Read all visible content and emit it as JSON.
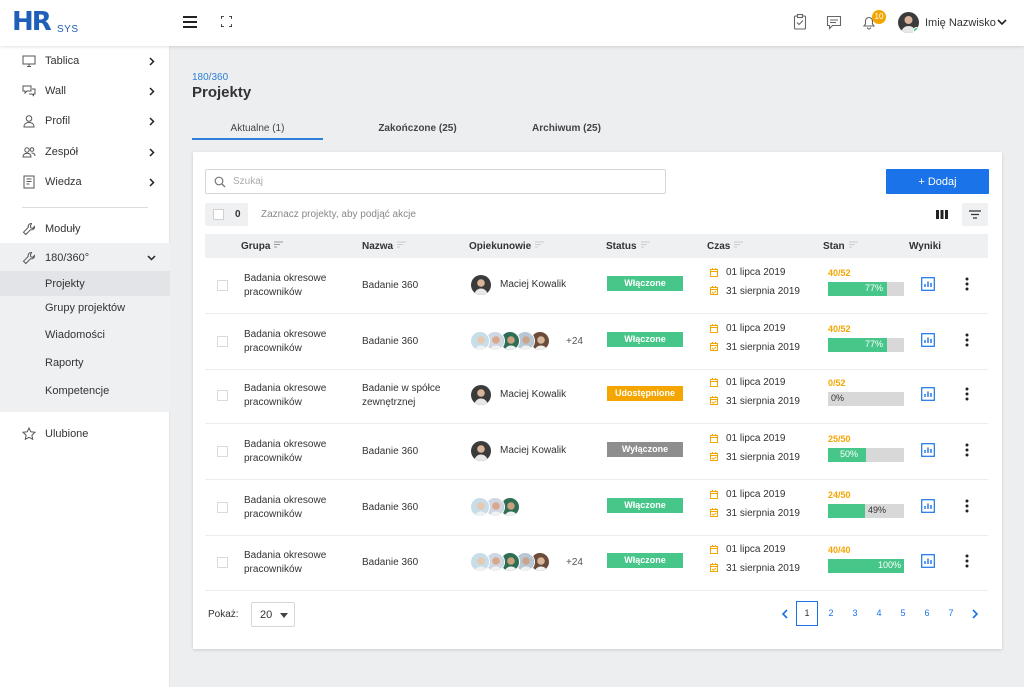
{
  "app": {
    "logo_main": "HR",
    "logo_sub": "SYS"
  },
  "topbar": {
    "notification_count": "10",
    "user_name": "Imię Nazwisko"
  },
  "sidebar": {
    "items": [
      {
        "label": "Tablica"
      },
      {
        "label": "Wall"
      },
      {
        "label": "Profil"
      },
      {
        "label": "Zespół"
      },
      {
        "label": "Wiedza"
      },
      {
        "label": "Moduły"
      },
      {
        "label": "180/360°"
      },
      {
        "label": "Ulubione"
      }
    ],
    "sub_items": [
      {
        "label": "Projekty"
      },
      {
        "label": "Grupy projektów"
      },
      {
        "label": "Wiadomości"
      },
      {
        "label": "Raporty"
      },
      {
        "label": "Kompetencje"
      }
    ]
  },
  "header": {
    "breadcrumb": "180/360",
    "title": "Projekty"
  },
  "tabs": [
    {
      "label": "Aktualne (1)"
    },
    {
      "label": "Zakończone (25)"
    },
    {
      "label": "Archiwum (25)"
    }
  ],
  "toolbar": {
    "search_placeholder": "Szukaj",
    "add_label": "+ Dodaj",
    "selected_count": "0",
    "selection_hint": "Zaznacz projekty, aby podjąć akcje"
  },
  "table": {
    "headers": {
      "grupa": "Grupa",
      "nazwa": "Nazwa",
      "opiekunowie": "Opiekunowie",
      "status": "Status",
      "czas": "Czas",
      "stan": "Stan",
      "wyniki": "Wyniki"
    },
    "status_colors": {
      "Włączone": "#47c68a",
      "Udostępnione": "#f5a500",
      "Wyłączone": "#8e8e8e"
    },
    "rows": [
      {
        "grupa": "Badania okresowe pracowników",
        "nazwa": "Badanie 360",
        "nazwa_lines": 1,
        "caretakers_mode": "single",
        "caretaker_name": "Maciej Kowalik",
        "more_count": "",
        "status": "Włączone",
        "date_start": "01 lipca 2019",
        "date_end": "31 sierpnia 2019",
        "stan": "40/52",
        "progress": 77,
        "progress_label": "77%"
      },
      {
        "grupa": "Badania okresowe pracowników",
        "nazwa": "Badanie 360",
        "nazwa_lines": 1,
        "caretakers_mode": "multi5",
        "caretaker_name": "",
        "more_count": "+24",
        "status": "Włączone",
        "date_start": "01 lipca 2019",
        "date_end": "31 sierpnia 2019",
        "stan": "40/52",
        "progress": 77,
        "progress_label": "77%"
      },
      {
        "grupa": "Badania okresowe pracowników",
        "nazwa": "Badanie w spółce zewnętrznej",
        "nazwa_lines": 2,
        "caretakers_mode": "single",
        "caretaker_name": "Maciej Kowalik",
        "more_count": "",
        "status": "Udostępnione",
        "date_start": "01 lipca 2019",
        "date_end": "31 sierpnia 2019",
        "stan": "0/52",
        "progress": 0,
        "progress_label": "0%"
      },
      {
        "grupa": "Badania okresowe pracowników",
        "nazwa": "Badanie 360",
        "nazwa_lines": 1,
        "caretakers_mode": "single",
        "caretaker_name": "Maciej Kowalik",
        "more_count": "",
        "status": "Wyłączone",
        "date_start": "01 lipca 2019",
        "date_end": "31 sierpnia 2019",
        "stan": "25/50",
        "progress": 50,
        "progress_label": "50%"
      },
      {
        "grupa": "Badania okresowe pracowników",
        "nazwa": "Badanie 360",
        "nazwa_lines": 1,
        "caretakers_mode": "multi3",
        "caretaker_name": "",
        "more_count": "",
        "status": "Włączone",
        "date_start": "01 lipca 2019",
        "date_end": "31 sierpnia 2019",
        "stan": "24/50",
        "progress": 49,
        "progress_label": "49%"
      },
      {
        "grupa": "Badania okresowe pracowników",
        "nazwa": "Badanie 360",
        "nazwa_lines": 1,
        "caretakers_mode": "multi5",
        "caretaker_name": "",
        "more_count": "+24",
        "status": "Włączone",
        "date_start": "01 lipca 2019",
        "date_end": "31 sierpnia 2019",
        "stan": "40/40",
        "progress": 100,
        "progress_label": "100%"
      }
    ]
  },
  "footer": {
    "show_label": "Pokaż:",
    "page_size": "20",
    "pages": [
      "1",
      "2",
      "3",
      "4",
      "5",
      "6",
      "7"
    ],
    "current_page": "1"
  }
}
